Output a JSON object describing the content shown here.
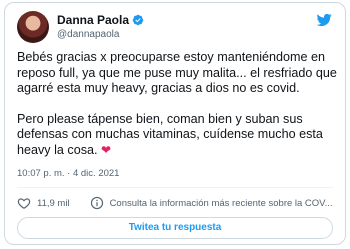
{
  "author": {
    "display_name": "Danna Paola",
    "handle": "@dannapaola"
  },
  "tweet": {
    "paragraph1": "Bebés gracias x preocuparse estoy manteniéndome en reposo full, ya que me puse muy malita... el resfriado que agarré esta muy heavy, gracias a dios no es covid.",
    "paragraph2": "Pero please tápense bien, coman bien y suban sus defensas con muchas vitaminas, cuídense mucho esta heavy la cosa.",
    "emoji": "❤"
  },
  "meta": {
    "timestamp": "10:07 p. m. · 4 dic. 2021"
  },
  "actions": {
    "like_count": "11,9 mil",
    "info_text": "Consulta la información más reciente sobre la COV..."
  },
  "reply_button": {
    "label": "Twitea tu respuesta"
  },
  "colors": {
    "accent": "#1d9bf0",
    "heart": "#e0245e",
    "text": "#0f1419",
    "secondary": "#536471"
  }
}
